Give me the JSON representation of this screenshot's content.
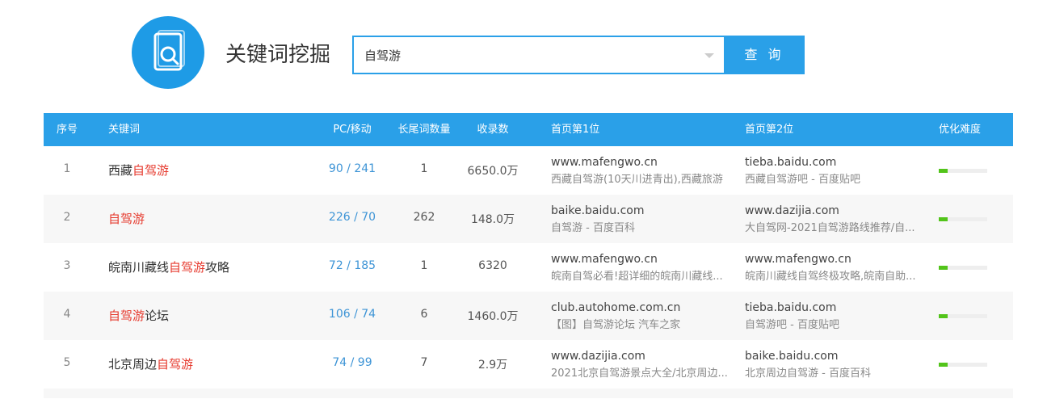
{
  "header": {
    "title": "关键词挖掘",
    "search_value": "自驾游",
    "search_button": "查 询"
  },
  "table": {
    "headers": {
      "idx": "序号",
      "keyword": "关键词",
      "pc_mobile": "PC/移动",
      "long_tail": "长尾词数量",
      "records": "收录数",
      "page1": "首页第1位",
      "page2": "首页第2位",
      "difficulty": "优化难度"
    },
    "rows": [
      {
        "idx": "1",
        "kw_pre": "西藏",
        "kw_hl": "自驾游",
        "kw_post": "",
        "pc_mobile": "90 / 241",
        "long_tail": "1",
        "records": "6650.0万",
        "p1_site": "www.mafengwo.cn",
        "p1_desc": "西藏自驾游(10天川进青出),西藏旅游",
        "p2_site": "tieba.baidu.com",
        "p2_desc": "西藏自驾游吧 - 百度贴吧",
        "difficulty": 0.18
      },
      {
        "idx": "2",
        "kw_pre": "",
        "kw_hl": "自驾游",
        "kw_post": "",
        "pc_mobile": "226 / 70",
        "long_tail": "262",
        "records": "148.0万",
        "p1_site": "baike.baidu.com",
        "p1_desc": "自驾游 - 百度百科",
        "p2_site": "www.dazijia.com",
        "p2_desc": "大自驾网-2021自驾游路线推荐/自...",
        "difficulty": 0.18
      },
      {
        "idx": "3",
        "kw_pre": "皖南川藏线",
        "kw_hl": "自驾游",
        "kw_post": "攻略",
        "pc_mobile": "72 / 185",
        "long_tail": "1",
        "records": "6320",
        "p1_site": "www.mafengwo.cn",
        "p1_desc": "皖南自驾必看!超详细的皖南川藏线...",
        "p2_site": "www.mafengwo.cn",
        "p2_desc": "皖南川藏线自驾终极攻略,皖南自助...",
        "difficulty": 0.18
      },
      {
        "idx": "4",
        "kw_pre": "",
        "kw_hl": "自驾游",
        "kw_post": "论坛",
        "pc_mobile": "106 / 74",
        "long_tail": "6",
        "records": "1460.0万",
        "p1_site": "club.autohome.com.cn",
        "p1_desc": "【图】自驾游论坛 汽车之家",
        "p2_site": "tieba.baidu.com",
        "p2_desc": "自驾游吧 - 百度贴吧",
        "difficulty": 0.18
      },
      {
        "idx": "5",
        "kw_pre": "北京周边",
        "kw_hl": "自驾游",
        "kw_post": "",
        "pc_mobile": "74 / 99",
        "long_tail": "7",
        "records": "2.9万",
        "p1_site": "www.dazijia.com",
        "p1_desc": "2021北京自驾游景点大全/北京周边...",
        "p2_site": "baike.baidu.com",
        "p2_desc": "北京周边自驾游 - 百度百科",
        "difficulty": 0.18
      }
    ]
  },
  "colors": {
    "accent": "#2aa0e8",
    "highlight": "#e63a2e",
    "difficulty_fill": "#52c41a"
  }
}
